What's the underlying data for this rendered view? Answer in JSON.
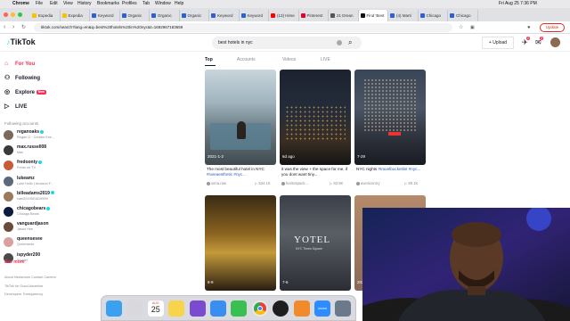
{
  "menubar": {
    "app": "Chrome",
    "menus": [
      "File",
      "Edit",
      "View",
      "History",
      "Bookmarks",
      "Profiles",
      "Tab",
      "Window",
      "Help"
    ],
    "datetime": "Fri Aug 25  7:36 PM"
  },
  "browser": {
    "tabs": [
      {
        "title": "Expedia",
        "color": "#f6c200"
      },
      {
        "title": "Expedia",
        "color": "#f6c200"
      },
      {
        "title": "Keyword",
        "color": "#2f5fd0"
      },
      {
        "title": "Organic",
        "color": "#2f5fd0"
      },
      {
        "title": "Organic",
        "color": "#2f5fd0"
      },
      {
        "title": "Organic",
        "color": "#2f5fd0"
      },
      {
        "title": "Keyword",
        "color": "#2f5fd0"
      },
      {
        "title": "Keyword",
        "color": "#2f5fd0"
      },
      {
        "title": "(13) Hime",
        "color": "#ff0000"
      },
      {
        "title": "Pinterest",
        "color": "#e60023"
      },
      {
        "title": "21 Drean",
        "color": "#555555"
      },
      {
        "title": "Find 'Best",
        "color": "#111111"
      },
      {
        "title": "(4) Marti",
        "color": "#2f5fd0"
      },
      {
        "title": "Chicago",
        "color": "#2f5fd0"
      },
      {
        "title": "Chicago",
        "color": "#2f5fd0"
      }
    ],
    "url": "tiktok.com/search?lang=en&q=best%20hotels%20in%20nyc&t=1692967183659",
    "update_label": "Update"
  },
  "tiktok": {
    "logo": "TikTok",
    "search_value": "best hotels in nyc",
    "upload_label": "+ Upload",
    "badges": {
      "inbox": "2",
      "messages": "2"
    },
    "nav": {
      "for_you": "For You",
      "following": "Following",
      "explore": "Explore",
      "explore_badge": "New",
      "live": "LIVE"
    },
    "following_title": "Following accounts",
    "accounts": [
      {
        "name": "reganoaks",
        "sub": "Regan O · Creator Ess...",
        "color": "#7b6a5a"
      },
      {
        "name": "max.russell08",
        "sub": "Max",
        "color": "#3a3a3a"
      },
      {
        "name": "fredoonty",
        "sub": "Fredo on TV",
        "color": "#c85a3a"
      },
      {
        "name": "lukeamz",
        "sub": "Luke Holtz | Amazon F...",
        "color": "#5a6a7a"
      },
      {
        "name": "billeadams2019",
        "sub": "cam2019DEAD5999",
        "color": "#9a7a5a"
      },
      {
        "name": "chicagobears",
        "sub": "Chicago Bears",
        "color": "#0b1c3d"
      },
      {
        "name": "vanguardjason",
        "sub": "Jason Hee",
        "color": "#6a4a3a"
      },
      {
        "name": "queensesee",
        "sub": "Queensese",
        "color": "#d9a0a0"
      },
      {
        "name": "ispyder200",
        "sub": "Spyder",
        "color": "#4a4a4a"
      }
    ],
    "see_more": "See more",
    "footer": [
      "About  Newsroom  Contact  Careers",
      "TikTok for Good  Advertise",
      "Developers  Transparency"
    ],
    "search_tabs": [
      "Top",
      "Accounts",
      "Videos",
      "LIVE"
    ],
    "videos": [
      {
        "label": "2021-1-2",
        "caption": "The most beautiful hotel in NYC ",
        "tag": "#rareaesthetic #nyc...",
        "author": "xena.raw",
        "views": "524.1K",
        "bg": "linear-gradient(180deg,#c9d6dc 0%,#9fb3bd 35%,#6f7f86 60%,#3f4a4f 100%)"
      },
      {
        "label": "6d ago",
        "caption": "it was the view + the space for me. if you dont want tiny...",
        "tag": "",
        "author": "heritospack...",
        "views": "93.5K",
        "bg": "linear-gradient(180deg,#1c2230 0%,#262d3a 45%,#3a2e24 75%,#141414 100%)"
      },
      {
        "label": "7-29",
        "caption": "NYC nights ",
        "tag": "#travelbucketlist #nyc...",
        "author": "avenicerory",
        "views": "90.1K",
        "bg": "linear-gradient(180deg,#394657 0%,#4a5566 40%,#2b2f38 75%,#191b22 100%)"
      },
      {
        "label": "8-9",
        "caption": "",
        "tag": "",
        "author": "",
        "views": "",
        "bg": "linear-gradient(180deg,#3a2a14 0%,#8a6320 40%,#c49a3a 60%,#2a1e12 100%)"
      },
      {
        "label": "7-6",
        "caption": "",
        "tag": "",
        "author": "",
        "views": "",
        "bg": "linear-gradient(180deg,#3b3f47 0%,#5a5f66 40%,#2b2d33 100%)"
      },
      {
        "label": "2022",
        "caption": "",
        "tag": "",
        "author": "",
        "views": "",
        "bg": "linear-gradient(180deg,#b58a6a 0%,#8a6a55 100%)"
      }
    ],
    "video_overlay_texts": {
      "yotel": "YOTEL",
      "yotel_sub": "NYC Times Square"
    }
  },
  "dock": {
    "calendar_month": "AUG",
    "calendar_day": "25",
    "apps": [
      {
        "name": "finder",
        "color": "#3aa0f0"
      },
      {
        "name": "launchpad",
        "color": "#d8d8dd"
      },
      {
        "name": "calendar",
        "color": "#ffffff"
      },
      {
        "name": "notes",
        "color": "#f7d44a"
      },
      {
        "name": "affinity",
        "color": "#7a4ad0"
      },
      {
        "name": "mail",
        "color": "#3a8ef0"
      },
      {
        "name": "messages",
        "color": "#3ac050"
      },
      {
        "name": "chrome",
        "color": "#e8e8e8"
      },
      {
        "name": "obs",
        "color": "#1e1e1e"
      },
      {
        "name": "pencil",
        "color": "#f08a2a"
      },
      {
        "name": "zoom",
        "color": "#2d8cff"
      },
      {
        "name": "preview",
        "color": "#6b7a8a"
      }
    ],
    "zoom_label": "zoom"
  }
}
